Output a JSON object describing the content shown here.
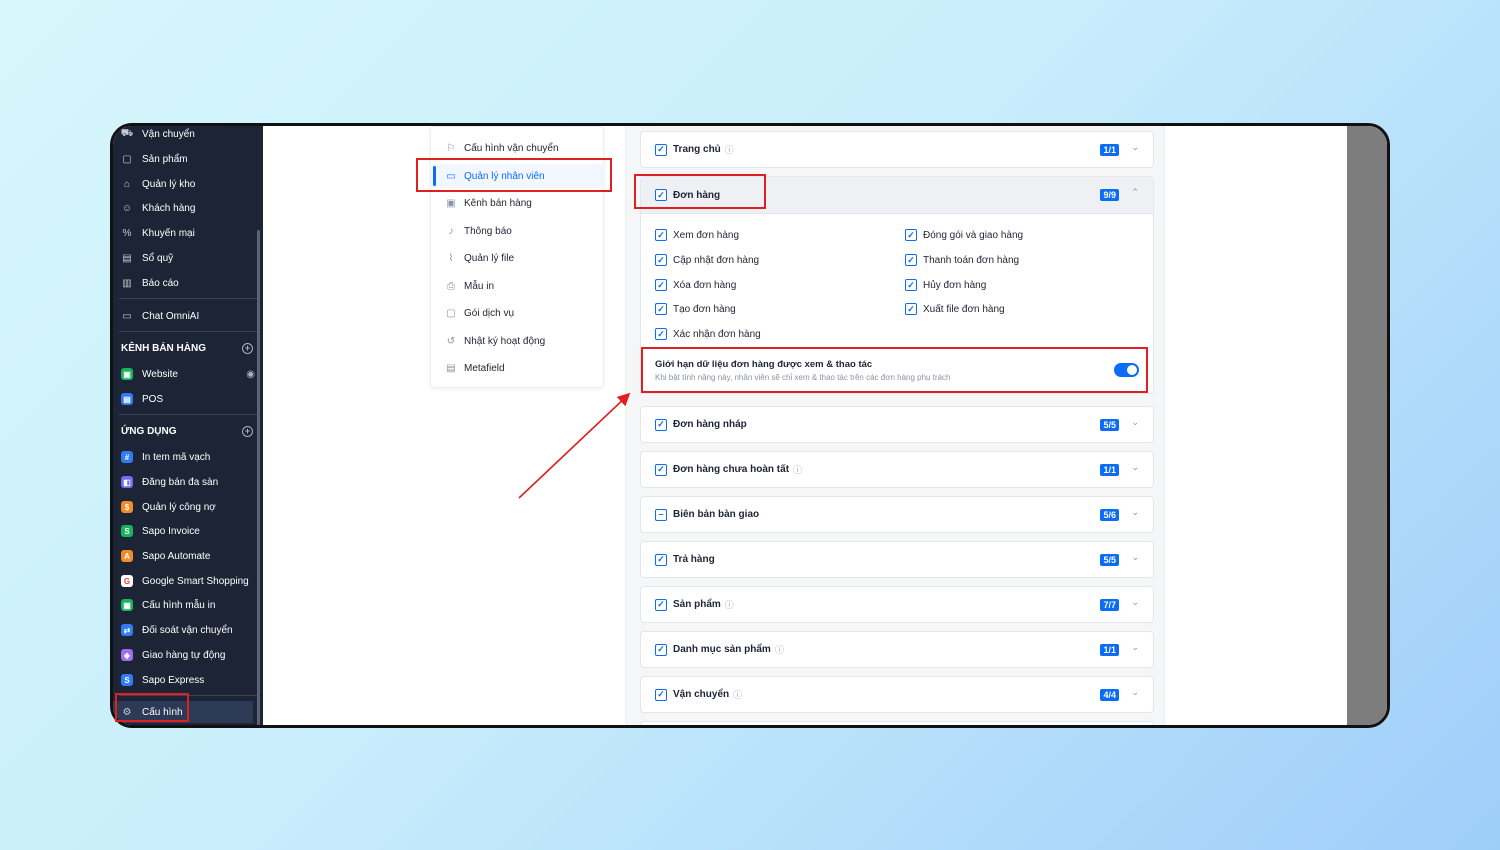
{
  "sidebar": {
    "items": [
      {
        "icon": "truck-icon",
        "label": "Vận chuyển"
      },
      {
        "icon": "box-icon",
        "label": "Sản phẩm"
      },
      {
        "icon": "warehouse-icon",
        "label": "Quản lý kho"
      },
      {
        "icon": "user-icon",
        "label": "Khách hàng"
      },
      {
        "icon": "discount-icon",
        "label": "Khuyến mại"
      },
      {
        "icon": "cashbook-icon",
        "label": "Sổ quỹ"
      },
      {
        "icon": "chart-icon",
        "label": "Báo cáo"
      }
    ],
    "chat": {
      "icon": "chat-icon",
      "label": "Chat OmniAI"
    },
    "sales_channels": {
      "title": "KÊNH BÁN HÀNG",
      "items": [
        {
          "label": "Website",
          "color": "#19b55e"
        },
        {
          "label": "POS",
          "color": "#2f7cf6"
        }
      ]
    },
    "apps": {
      "title": "ỨNG DỤNG",
      "items": [
        {
          "label": "In tem mã vạch",
          "color": "#2f7cf6"
        },
        {
          "label": "Đăng bán đa sàn",
          "color": "#6e6ef0"
        },
        {
          "label": "Quản lý công nợ",
          "color": "#f28c28"
        },
        {
          "label": "Sapo Invoice",
          "color": "#19b55e"
        },
        {
          "label": "Sapo Automate",
          "color": "#f28c28"
        },
        {
          "label": "Google Smart Shopping",
          "color": "#ea4335"
        },
        {
          "label": "Cấu hình mẫu in",
          "color": "#19b55e"
        },
        {
          "label": "Đối soát vận chuyển",
          "color": "#2f7cf6"
        },
        {
          "label": "Giao hàng tự động",
          "color": "#a16cf0"
        },
        {
          "label": "Sapo Express",
          "color": "#2f7cf6"
        }
      ]
    },
    "settings": {
      "icon": "gear-icon",
      "label": "Cấu hình"
    }
  },
  "submenu": [
    {
      "icon": "shipping-config-icon",
      "label": "Cấu hình vận chuyển"
    },
    {
      "icon": "staff-card-icon",
      "label": "Quản lý nhân viên",
      "active": true
    },
    {
      "icon": "channel-icon",
      "label": "Kênh bán hàng"
    },
    {
      "icon": "bell-icon",
      "label": "Thông báo"
    },
    {
      "icon": "paperclip-icon",
      "label": "Quản lý file"
    },
    {
      "icon": "printer-icon",
      "label": "Mẫu in"
    },
    {
      "icon": "package-icon",
      "label": "Gói dịch vụ"
    },
    {
      "icon": "history-icon",
      "label": "Nhật ký hoạt động"
    },
    {
      "icon": "metafield-icon",
      "label": "Metafield"
    }
  ],
  "permissions": {
    "home": {
      "label": "Trang chủ",
      "badge": "1/1"
    },
    "orders": {
      "label": "Đơn hàng",
      "badge": "9/9",
      "left": [
        "Xem đơn hàng",
        "Cập nhật đơn hàng",
        "Xóa đơn hàng",
        "Tạo đơn hàng",
        "Xác nhận đơn hàng"
      ],
      "right": [
        "Đóng gói và giao hàng",
        "Thanh toán đơn hàng",
        "Hủy đơn hàng",
        "Xuất file đơn hàng"
      ],
      "limit_title": "Giới hạn dữ liệu đơn hàng được xem & thao tác",
      "limit_desc": "Khi bật tính năng này, nhân viên sẽ chỉ xem & thao tác trên các đơn hàng phụ trách",
      "limit_enabled": true
    },
    "groups": [
      {
        "label": "Đơn hàng nháp",
        "badge": "5/5",
        "help": false,
        "state": "checked"
      },
      {
        "label": "Đơn hàng chưa hoàn tất",
        "badge": "1/1",
        "help": true,
        "state": "checked"
      },
      {
        "label": "Biên bản bàn giao",
        "badge": "5/6",
        "help": false,
        "state": "partial"
      },
      {
        "label": "Trả hàng",
        "badge": "5/5",
        "help": false,
        "state": "checked"
      },
      {
        "label": "Sản phẩm",
        "badge": "7/7",
        "help": true,
        "state": "checked"
      },
      {
        "label": "Danh mục sản phẩm",
        "badge": "1/1",
        "help": true,
        "state": "checked"
      },
      {
        "label": "Vận chuyển",
        "badge": "4/4",
        "help": true,
        "state": "checked"
      }
    ]
  },
  "colors": {
    "accent": "#0b6cf5",
    "highlight": "#e02020",
    "sidebar": "#1c2435"
  }
}
